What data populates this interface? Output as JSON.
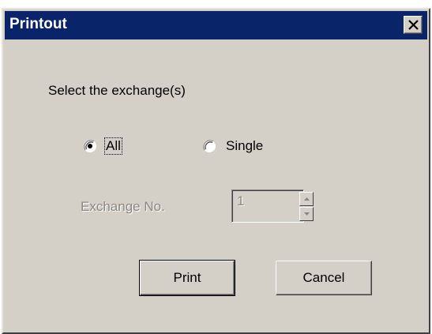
{
  "window": {
    "title": "Printout"
  },
  "group": {
    "prompt": "Select the exchange(s)",
    "options": [
      {
        "label": "All",
        "selected": true
      },
      {
        "label": "Single",
        "selected": false
      }
    ]
  },
  "exchange": {
    "label": "Exchange No.",
    "value": "1",
    "enabled": false
  },
  "buttons": {
    "print": "Print",
    "cancel": "Cancel"
  },
  "icons": {
    "close": "close-icon",
    "spin_up": "chevron-up-icon",
    "spin_down": "chevron-down-icon"
  },
  "colors": {
    "titlebar": "#0a246a",
    "dialog": "#d4d0c8",
    "disabled_text": "#8a8781"
  }
}
